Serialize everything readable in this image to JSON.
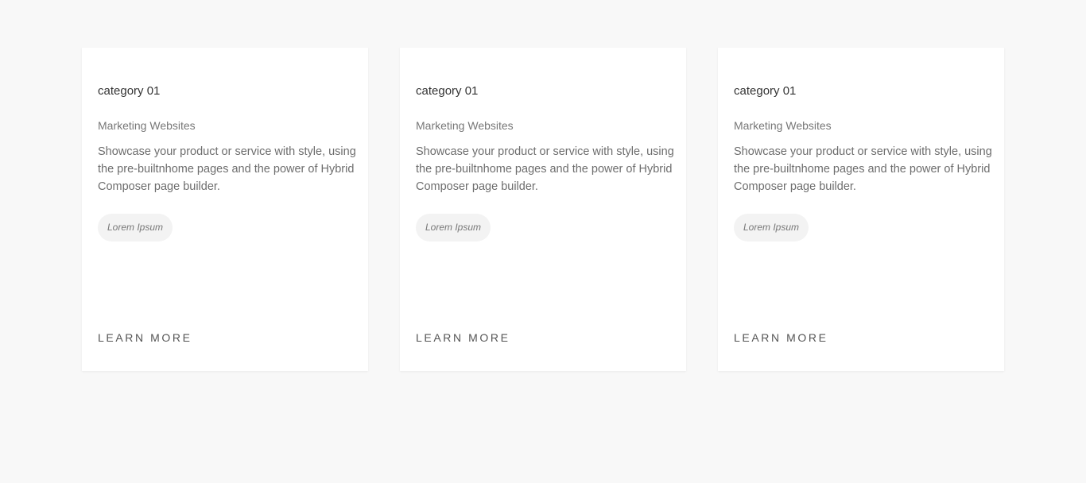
{
  "cards": [
    {
      "category": "category 01",
      "subtitle": "Marketing Websites",
      "description": "Showcase your product or service with style, using the pre-builtnhome pages and the power of Hybrid Composer page builder.",
      "tag": "Lorem Ipsum",
      "link_label": "LEARN MORE"
    },
    {
      "category": "category 01",
      "subtitle": "Marketing Websites",
      "description": "Showcase your product or service with style, using the pre-builtnhome pages and the power of Hybrid Composer page builder.",
      "tag": "Lorem Ipsum",
      "link_label": "LEARN MORE"
    },
    {
      "category": "category 01",
      "subtitle": "Marketing Websites",
      "description": "Showcase your product or service with style, using the pre-builtnhome pages and the power of Hybrid Composer page builder.",
      "tag": "Lorem Ipsum",
      "link_label": "LEARN MORE"
    }
  ]
}
